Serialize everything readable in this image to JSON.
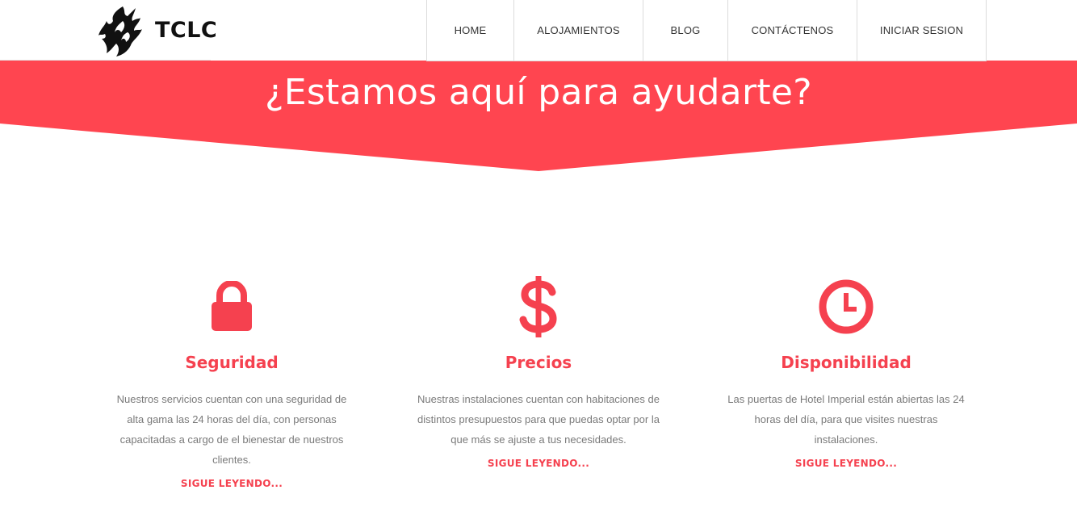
{
  "brand": {
    "name": "TCLC",
    "logo_icon": "flame-logo-icon"
  },
  "nav": {
    "items": [
      {
        "label": "HOME"
      },
      {
        "label": "ALOJAMIENTOS"
      },
      {
        "label": "BLOG"
      },
      {
        "label": "CONTÁCTENOS"
      },
      {
        "label": "INICIAR SESION"
      }
    ]
  },
  "banner": {
    "title": "¿Estamos aquí para ayudarte?"
  },
  "colors": {
    "accent": "#f5414f",
    "banner": "#ff4550"
  },
  "features": [
    {
      "icon": "lock-icon",
      "title": "Seguridad",
      "text": "Nuestros servicios cuentan con una seguridad de alta gama las 24 horas del día, con personas capacitadas a cargo de el bienestar de nuestros clientes.",
      "link": "SIGUE LEYENDO..."
    },
    {
      "icon": "dollar-icon",
      "title": "Precios",
      "text": "Nuestras instalaciones cuentan con habitaciones de distintos presupuestos para que puedas optar por la que más se ajuste a tus necesidades.",
      "link": "SIGUE LEYENDO..."
    },
    {
      "icon": "clock-icon",
      "title": "Disponibilidad",
      "text": "Las puertas de Hotel Imperial están abiertas las 24 horas del día, para que visites nuestras instalaciones.",
      "link": "SIGUE LEYENDO..."
    }
  ]
}
